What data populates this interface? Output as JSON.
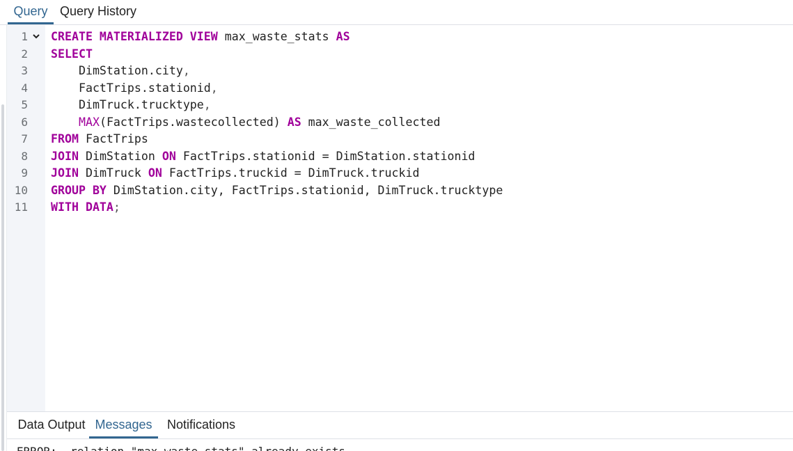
{
  "top_tabs": [
    {
      "label": "Query",
      "active": true
    },
    {
      "label": "Query History",
      "active": false
    }
  ],
  "editor": {
    "line_numbers": [
      "1",
      "2",
      "3",
      "4",
      "5",
      "6",
      "7",
      "8",
      "9",
      "10",
      "11"
    ],
    "lines": [
      [
        {
          "t": "CREATE MATERIALIZED VIEW",
          "k": "kw"
        },
        {
          "t": " max_waste_stats ",
          "k": "id"
        },
        {
          "t": "AS",
          "k": "kw"
        }
      ],
      [
        {
          "t": "SELECT",
          "k": "kw"
        }
      ],
      [
        {
          "t": "    DimStation.city",
          "k": "id"
        },
        {
          "t": ",",
          "k": "punc"
        }
      ],
      [
        {
          "t": "    FactTrips.stationid",
          "k": "id"
        },
        {
          "t": ",",
          "k": "punc"
        }
      ],
      [
        {
          "t": "    DimTruck.trucktype",
          "k": "id"
        },
        {
          "t": ",",
          "k": "punc"
        }
      ],
      [
        {
          "t": "    ",
          "k": "id"
        },
        {
          "t": "MAX",
          "k": "fn"
        },
        {
          "t": "(FactTrips.wastecollected) ",
          "k": "id"
        },
        {
          "t": "AS",
          "k": "kw"
        },
        {
          "t": " max_waste_collected",
          "k": "id"
        }
      ],
      [
        {
          "t": "FROM",
          "k": "kw"
        },
        {
          "t": " FactTrips",
          "k": "id"
        }
      ],
      [
        {
          "t": "JOIN",
          "k": "kw"
        },
        {
          "t": " DimStation ",
          "k": "id"
        },
        {
          "t": "ON",
          "k": "kw"
        },
        {
          "t": " FactTrips.stationid = DimStation.stationid",
          "k": "id"
        }
      ],
      [
        {
          "t": "JOIN",
          "k": "kw"
        },
        {
          "t": " DimTruck ",
          "k": "id"
        },
        {
          "t": "ON",
          "k": "kw"
        },
        {
          "t": " FactTrips.truckid = DimTruck.truckid",
          "k": "id"
        }
      ],
      [
        {
          "t": "GROUP BY",
          "k": "kw"
        },
        {
          "t": " DimStation.city, FactTrips.stationid, DimTruck.trucktype",
          "k": "id"
        }
      ],
      [
        {
          "t": "WITH DATA",
          "k": "kw"
        },
        {
          "t": ";",
          "k": "punc"
        }
      ]
    ]
  },
  "bottom_tabs": [
    {
      "label": "Data Output",
      "active": false
    },
    {
      "label": "Messages",
      "active": true
    },
    {
      "label": "Notifications",
      "active": false
    }
  ],
  "messages": {
    "text": "ERROR:  relation \"max_waste_stats\" already exists"
  },
  "colors": {
    "accent": "#326690",
    "keyword": "#a0009a",
    "gutter_bg": "#f3f5f9"
  }
}
